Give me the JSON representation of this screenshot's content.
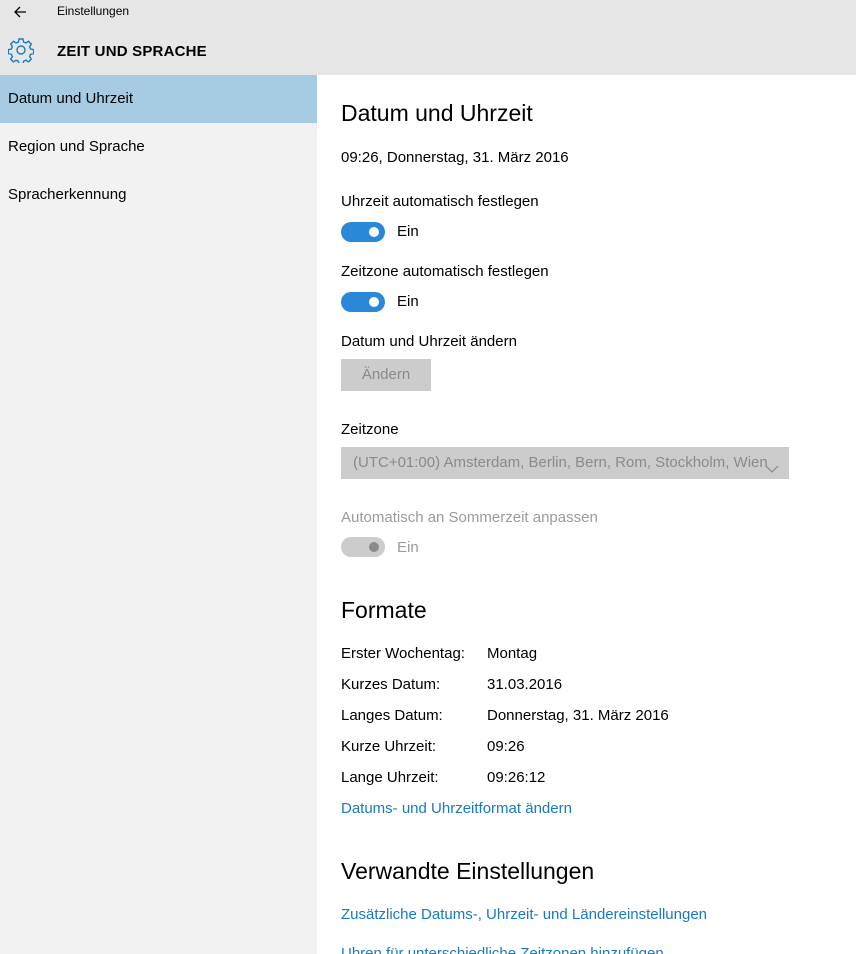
{
  "window": {
    "title": "Einstellungen"
  },
  "header": {
    "title": "ZEIT UND SPRACHE"
  },
  "sidebar": {
    "items": [
      {
        "label": "Datum und Uhrzeit",
        "active": true
      },
      {
        "label": "Region und Sprache",
        "active": false
      },
      {
        "label": "Spracherkennung",
        "active": false
      }
    ]
  },
  "main": {
    "section_title": "Datum und Uhrzeit",
    "current_datetime": "09:26, Donnerstag, 31. März 2016",
    "auto_time": {
      "label": "Uhrzeit automatisch festlegen",
      "state": "Ein"
    },
    "auto_timezone": {
      "label": "Zeitzone automatisch festlegen",
      "state": "Ein"
    },
    "change_datetime": {
      "label": "Datum und Uhrzeit ändern",
      "button": "Ändern"
    },
    "timezone": {
      "label": "Zeitzone",
      "value": "(UTC+01:00) Amsterdam, Berlin, Bern, Rom, Stockholm, Wien"
    },
    "dst": {
      "label": "Automatisch an Sommerzeit anpassen",
      "state": "Ein"
    },
    "formats": {
      "title": "Formate",
      "rows": [
        {
          "label": "Erster Wochentag:",
          "value": "Montag"
        },
        {
          "label": "Kurzes Datum:",
          "value": "31.03.2016"
        },
        {
          "label": "Langes Datum:",
          "value": "Donnerstag, 31. März 2016"
        },
        {
          "label": "Kurze Uhrzeit:",
          "value": "09:26"
        },
        {
          "label": "Lange Uhrzeit:",
          "value": "09:26:12"
        }
      ],
      "change_link": "Datums- und Uhrzeitformat ändern"
    },
    "related": {
      "title": "Verwandte Einstellungen",
      "links": [
        "Zusätzliche Datums-, Uhrzeit- und Ländereinstellungen",
        "Uhren für unterschiedliche Zeitzonen hinzufügen"
      ]
    }
  },
  "colors": {
    "accent": "#2b88d8",
    "selected_nav": "#a6cbe3",
    "link": "#1a7abf",
    "disabled": "#cccccc"
  }
}
